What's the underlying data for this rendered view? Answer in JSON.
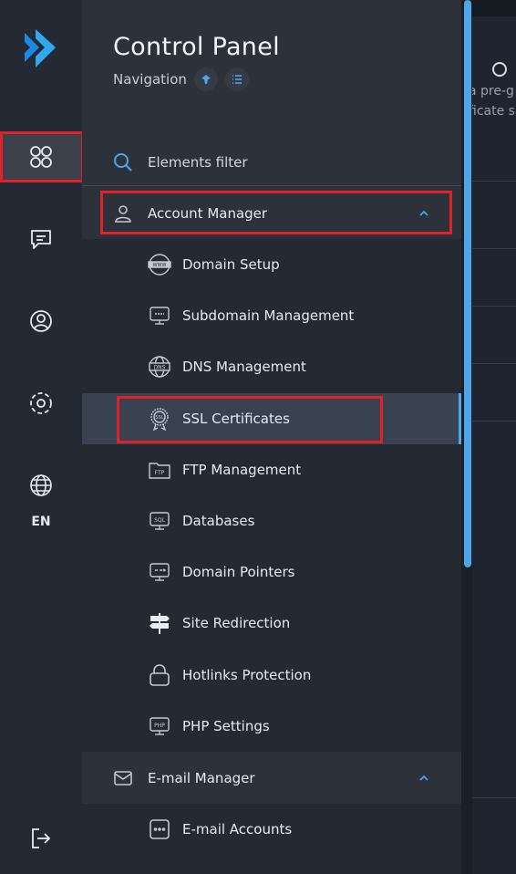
{
  "rail": {
    "items": [
      {
        "name": "apps-grid-icon",
        "active": true
      },
      {
        "name": "chat-icon",
        "active": false
      },
      {
        "name": "user-circle-icon",
        "active": false
      },
      {
        "name": "settings-icon",
        "active": false
      },
      {
        "name": "globe-icon",
        "active": false
      },
      {
        "name": "logout-icon",
        "active": false
      }
    ],
    "language": "EN"
  },
  "panel": {
    "title": "Control Panel",
    "subtitle": "Navigation",
    "filter_label": "Elements filter",
    "sections": [
      {
        "label": "Account Manager",
        "icon": "user-icon",
        "expanded": true,
        "items": [
          {
            "label": "Domain Setup",
            "icon": "www-icon"
          },
          {
            "label": "Subdomain Management",
            "icon": "subdomain-icon"
          },
          {
            "label": "DNS Management",
            "icon": "dns-icon"
          },
          {
            "label": "SSL Certificates",
            "icon": "ssl-icon",
            "selected": true
          },
          {
            "label": "FTP Management",
            "icon": "ftp-folder-icon"
          },
          {
            "label": "Databases",
            "icon": "sql-icon"
          },
          {
            "label": "Domain Pointers",
            "icon": "pointer-monitor-icon"
          },
          {
            "label": "Site Redirection",
            "icon": "signpost-icon"
          },
          {
            "label": "Hotlinks Protection",
            "icon": "lock-icon"
          },
          {
            "label": "PHP Settings",
            "icon": "php-icon"
          }
        ]
      },
      {
        "label": "E-mail Manager",
        "icon": "mail-icon",
        "expanded": true,
        "items": [
          {
            "label": "E-mail Accounts",
            "icon": "email-accounts-icon"
          }
        ]
      }
    ]
  },
  "background": {
    "text_line1": "a pre-g",
    "text_line2": "ficate s"
  },
  "colors": {
    "accent": "#4ea5e8",
    "highlight_red": "#e0212a",
    "rail_bg": "#242a33",
    "panel_bg": "#2c313a",
    "submenu_bg": "#252a32"
  }
}
